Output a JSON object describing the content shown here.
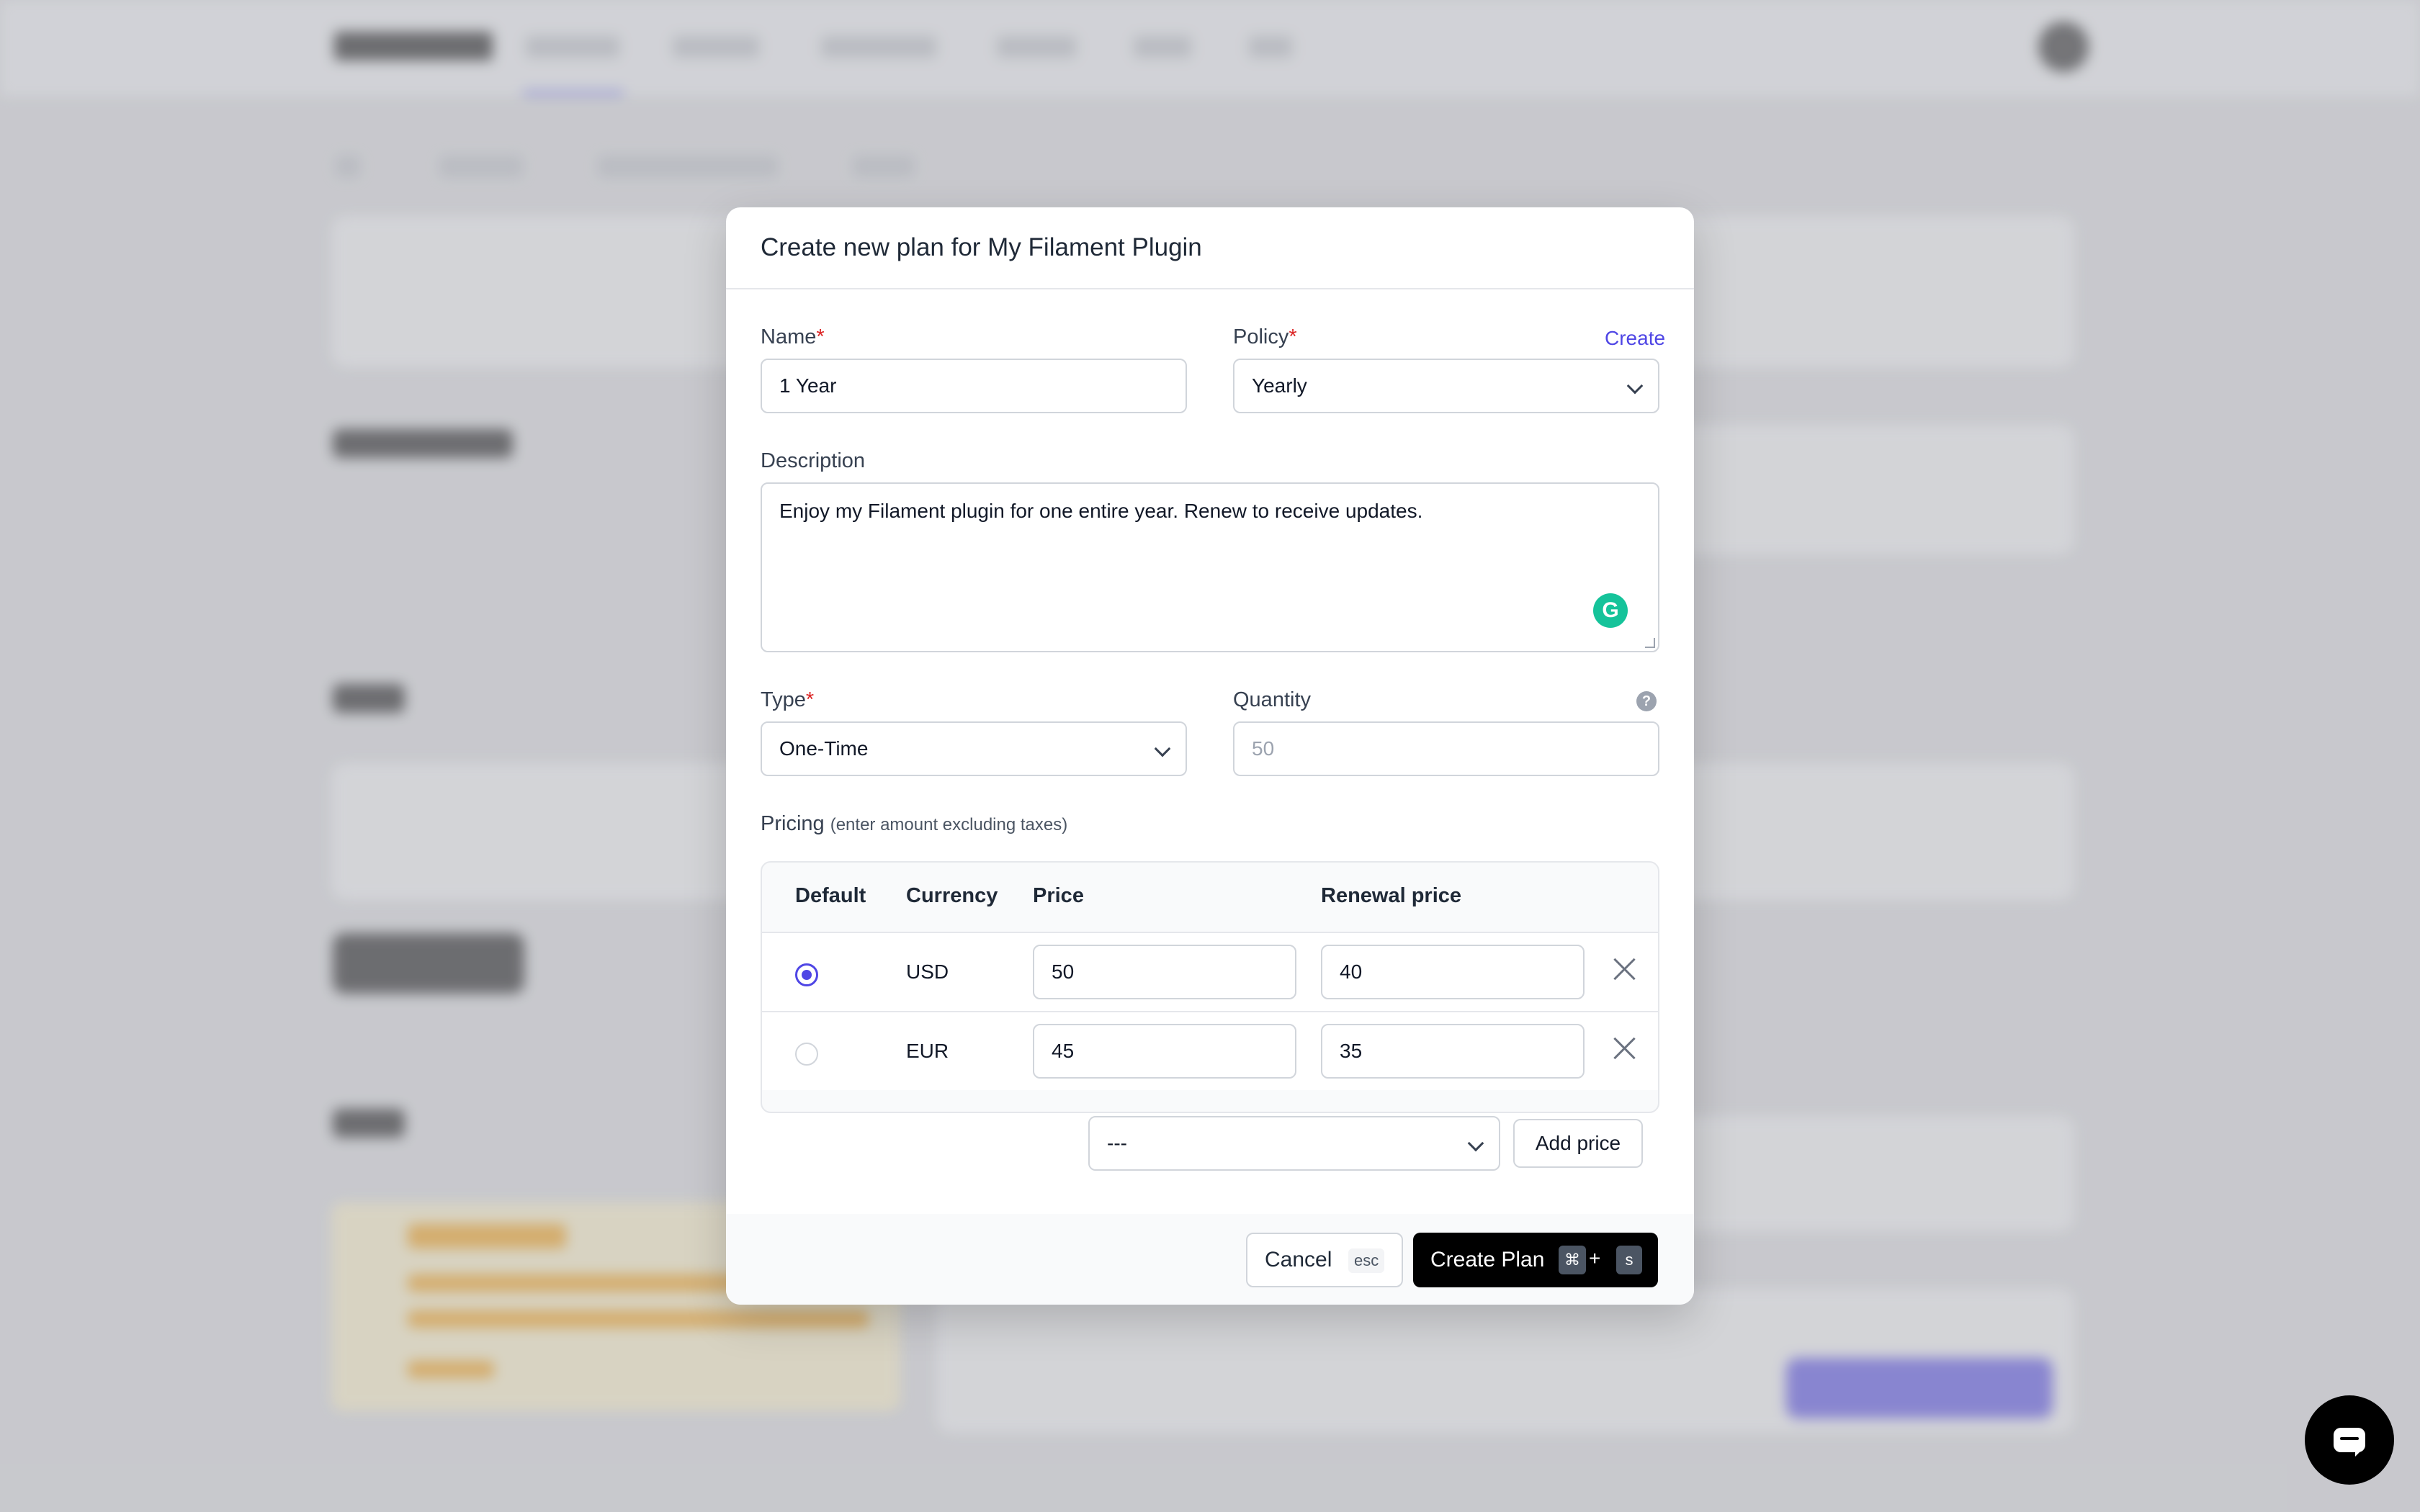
{
  "modal": {
    "title": "Create new plan for My Filament Plugin",
    "name": {
      "label": "Name",
      "required_mark": "*",
      "value": "1 Year"
    },
    "policy": {
      "label": "Policy",
      "required_mark": "*",
      "value": "Yearly",
      "create_link": "Create"
    },
    "description": {
      "label": "Description",
      "value": "Enjoy my Filament plugin for one entire year. Renew to receive updates."
    },
    "type": {
      "label": "Type",
      "required_mark": "*",
      "value": "One-Time"
    },
    "quantity": {
      "label": "Quantity",
      "placeholder": "50",
      "help_glyph": "?"
    },
    "pricing": {
      "label": "Pricing",
      "note": "(enter amount excluding taxes)",
      "columns": {
        "default": "Default",
        "currency": "Currency",
        "price": "Price",
        "renewal": "Renewal price"
      },
      "rows": [
        {
          "default": true,
          "currency": "USD",
          "price": "50",
          "renewal": "40"
        },
        {
          "default": false,
          "currency": "EUR",
          "price": "45",
          "renewal": "35"
        }
      ],
      "new_currency_value": "---",
      "add_button": "Add price"
    },
    "footer": {
      "cancel_label": "Cancel",
      "cancel_shortcut": "esc",
      "create_label": "Create Plan",
      "create_key_cmd": "⌘",
      "create_key_plus": "+",
      "create_key_s": "s"
    }
  },
  "colors": {
    "accent": "#4f46e5",
    "primary_button": "#000000",
    "required": "#dc2626",
    "grammarly": "#15c39a"
  },
  "icons": [
    "chevron-down-icon",
    "help-icon",
    "close-icon",
    "grammarly-icon",
    "chat-icon"
  ]
}
